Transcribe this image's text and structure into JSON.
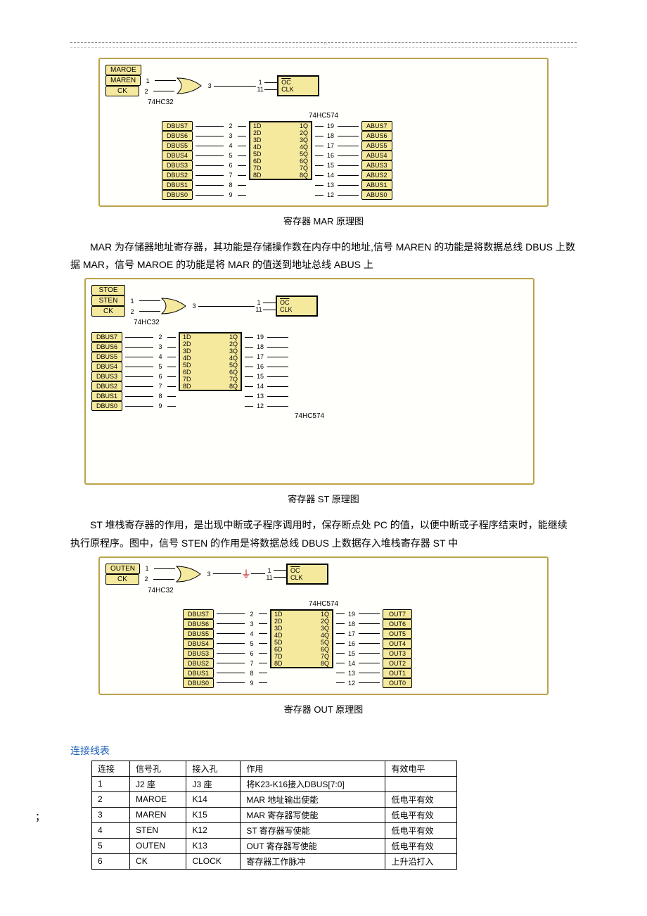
{
  "header_marker": "..",
  "diagram_mar": {
    "top_signals": [
      "MAROE",
      "MAREN",
      "CK"
    ],
    "gate_pins_in": [
      "1",
      "2"
    ],
    "gate_pin_out": "3",
    "gate_chip": "74HC32",
    "chip_name": "74HC574",
    "chip_ctrl_pins": [
      "1",
      "11"
    ],
    "chip_ctrl_labels": [
      "OC",
      "CLK"
    ],
    "left_bus": [
      "DBUS7",
      "DBUS6",
      "DBUS5",
      "DBUS4",
      "DBUS3",
      "DBUS2",
      "DBUS1",
      "DBUS0"
    ],
    "left_pins": [
      "2",
      "3",
      "4",
      "5",
      "6",
      "7",
      "8",
      "9"
    ],
    "d_labels": [
      "1D",
      "2D",
      "3D",
      "4D",
      "5D",
      "6D",
      "7D",
      "8D"
    ],
    "q_labels": [
      "1Q",
      "2Q",
      "3Q",
      "4Q",
      "5Q",
      "6Q",
      "7Q",
      "8Q"
    ],
    "right_pins": [
      "19",
      "18",
      "17",
      "16",
      "15",
      "14",
      "13",
      "12"
    ],
    "right_bus": [
      "ABUS7",
      "ABUS6",
      "ABUS5",
      "ABUS4",
      "ABUS3",
      "ABUS2",
      "ABUS1",
      "ABUS0"
    ],
    "caption": "寄存器 MAR 原理图"
  },
  "para_mar": "MAR 为存储器地址寄存器，其功能是存储操作数在内存中的地址,信号 MAREN 的功能是将数据总线 DBUS 上数据 MAR，信号 MAROE 的功能是将 MAR 的值送到地址总线 ABUS 上",
  "diagram_st": {
    "top_signals": [
      "STOE",
      "STEN",
      "CK"
    ],
    "gate_pins_in": [
      "1",
      "2"
    ],
    "gate_pin_out": "3",
    "gate_chip": "74HC32",
    "chip_name": "74HC574",
    "chip_ctrl_pins": [
      "1",
      "11"
    ],
    "chip_ctrl_labels": [
      "OC",
      "CLK"
    ],
    "left_bus": [
      "DBUS7",
      "DBUS6",
      "DBUS5",
      "DBUS4",
      "DBUS3",
      "DBUS2",
      "DBUS1",
      "DBUS0"
    ],
    "left_pins": [
      "2",
      "3",
      "4",
      "5",
      "6",
      "7",
      "8",
      "9"
    ],
    "d_labels": [
      "1D",
      "2D",
      "3D",
      "4D",
      "5D",
      "6D",
      "7D",
      "8D"
    ],
    "q_labels": [
      "1Q",
      "2Q",
      "3Q",
      "4Q",
      "5Q",
      "6Q",
      "7Q",
      "8Q"
    ],
    "right_pins": [
      "19",
      "18",
      "17",
      "16",
      "15",
      "14",
      "13",
      "12"
    ],
    "caption": "寄存器 ST 原理图"
  },
  "para_st": "ST 堆栈寄存器的作用，是出现中断或子程序调用时，保存断点处 PC 的值，以便中断或子程序结束时，能继续执行原程序。图中，信号 STEN 的作用是将数据总线 DBUS 上数据存入堆栈寄存器 ST 中",
  "diagram_out": {
    "top_signals": [
      "OUTEN",
      "CK"
    ],
    "gate_pins_in": [
      "1",
      "2"
    ],
    "gate_pin_out": "3",
    "gate_chip": "74HC32",
    "chip_name": "74HC574",
    "chip_ctrl_pins": [
      "1",
      "11"
    ],
    "chip_ctrl_labels": [
      "OC",
      "CLK"
    ],
    "left_bus": [
      "DBUS7",
      "DBUS6",
      "DBUS5",
      "DBUS4",
      "DBUS3",
      "DBUS2",
      "DBUS1",
      "DBUS0"
    ],
    "left_pins": [
      "2",
      "3",
      "4",
      "5",
      "6",
      "7",
      "8",
      "9"
    ],
    "d_labels": [
      "1D",
      "2D",
      "3D",
      "4D",
      "5D",
      "6D",
      "7D",
      "8D"
    ],
    "q_labels": [
      "1Q",
      "2Q",
      "3Q",
      "4Q",
      "5Q",
      "6Q",
      "7Q",
      "8Q"
    ],
    "right_pins": [
      "19",
      "18",
      "17",
      "16",
      "15",
      "14",
      "13",
      "12"
    ],
    "right_bus": [
      "OUT7",
      "OUT6",
      "OUT5",
      "OUT4",
      "OUT3",
      "OUT2",
      "OUT1",
      "OUT0"
    ],
    "caption": "寄存器 OUT 原理图"
  },
  "table": {
    "title": "连接线表",
    "headers": [
      "连接",
      "信号孔",
      "接入孔",
      "作用",
      "有效电平"
    ],
    "rows": [
      [
        "1",
        "J2 座",
        "J3 座",
        "将K23-K16接入DBUS[7:0]",
        ""
      ],
      [
        "2",
        "MAROE",
        "K14",
        "MAR 地址输出使能",
        "低电平有效"
      ],
      [
        "3",
        "MAREN",
        "K15",
        "MAR 寄存器写使能",
        "低电平有效"
      ],
      [
        "4",
        "STEN",
        "K12",
        "ST 寄存器写使能",
        "低电平有效"
      ],
      [
        "5",
        "OUTEN",
        "K13",
        "OUT 寄存器写使能",
        "低电平有效"
      ],
      [
        "6",
        "CK",
        "CLOCK",
        "寄存器工作脉冲",
        "上升沿打入"
      ]
    ]
  }
}
